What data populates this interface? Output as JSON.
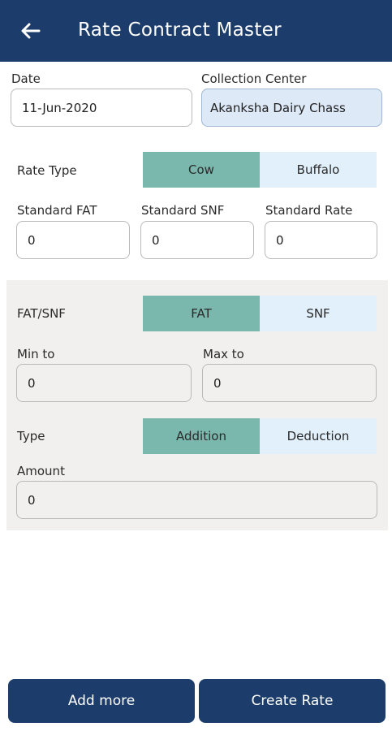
{
  "header": {
    "title": "Rate Contract Master",
    "back_icon": "arrow-left-icon"
  },
  "form": {
    "date_label": "Date",
    "date_value": "11-Jun-2020",
    "center_label": "Collection Center",
    "center_value": "Akanksha Dairy Chass",
    "rate_type_label": "Rate Type",
    "rate_type_options": [
      "Cow",
      "Buffalo"
    ],
    "rate_type_selected": "Cow",
    "std_fat_label": "Standard FAT",
    "std_fat_value": "0",
    "std_snf_label": "Standard SNF",
    "std_snf_value": "0",
    "std_rate_label": "Standard Rate",
    "std_rate_value": "0"
  },
  "rule": {
    "fat_snf_label": "FAT/SNF",
    "fat_snf_options": [
      "FAT",
      "SNF"
    ],
    "fat_snf_selected": "FAT",
    "min_label": "Min to",
    "min_value": "0",
    "max_label": "Max to",
    "max_value": "0",
    "type_label": "Type",
    "type_options": [
      "Addition",
      "Deduction"
    ],
    "type_selected": "Addition",
    "amount_label": "Amount",
    "amount_value": "0"
  },
  "actions": {
    "add_more": "Add more",
    "create_rate": "Create Rate"
  },
  "colors": {
    "primary": "#1c3d6b",
    "selected": "#7ab8ae",
    "unselected": "#e1f0fb",
    "panel": "#f1f0ee"
  }
}
